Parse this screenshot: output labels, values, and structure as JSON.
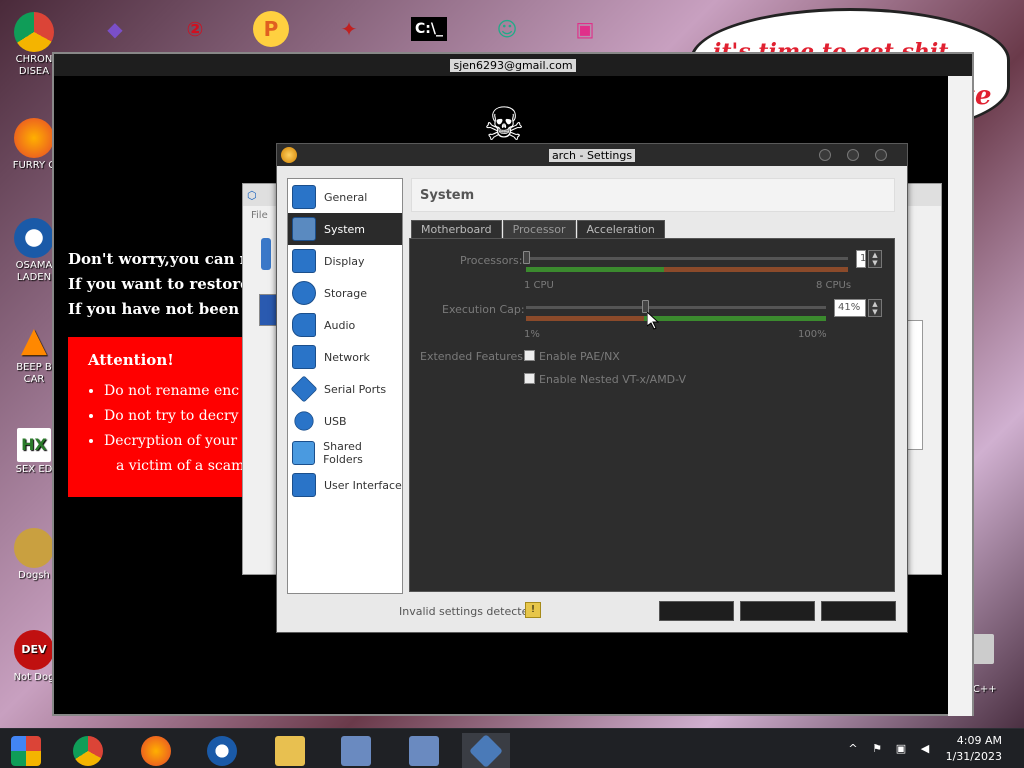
{
  "desktop": {
    "icons": [
      {
        "label": "CHRON\nDISEA",
        "icon": "chrome-icon"
      },
      {
        "label": "FURRY C",
        "icon": "firefox-icon"
      },
      {
        "label": "OSAMA\nLADEN",
        "icon": "obama-icon"
      },
      {
        "label": "BEEP B\nCAR",
        "icon": "vlc-icon"
      },
      {
        "label": "SEX ED",
        "icon": "hex-icon"
      },
      {
        "label": "Dogsh",
        "icon": "dog-icon"
      },
      {
        "label": "Not Dog",
        "icon": "devcpp-icon"
      }
    ],
    "right_labels": [
      "n C++"
    ],
    "speech_text": "it's time to get shit",
    "speech_text2": "te"
  },
  "remote_window": {
    "title": "sjen6293@gmail.com",
    "ransom_lines": [
      "Don't worry,you can ret",
      "If you want to restore t",
      "If you have not been an"
    ],
    "attention_title": "Attention!",
    "attention_items": [
      "Do not rename enc",
      "Do not try to decry",
      "Decryption of your"
    ],
    "attention_cont": "a victim of a scam."
  },
  "vbox_manager": {
    "file_menu": "File"
  },
  "settings_dialog": {
    "title": "arch - Settings",
    "section_title": "System",
    "sidebar": [
      {
        "label": "General",
        "icon": "general-icon",
        "active": false
      },
      {
        "label": "System",
        "icon": "system-icon",
        "active": true
      },
      {
        "label": "Display",
        "icon": "display-icon",
        "active": false
      },
      {
        "label": "Storage",
        "icon": "storage-icon",
        "active": false
      },
      {
        "label": "Audio",
        "icon": "audio-icon",
        "active": false
      },
      {
        "label": "Network",
        "icon": "network-icon",
        "active": false
      },
      {
        "label": "Serial Ports",
        "icon": "serial-ports-icon",
        "active": false
      },
      {
        "label": "USB",
        "icon": "usb-icon",
        "active": false
      },
      {
        "label": "Shared Folders",
        "icon": "shared-folders-icon",
        "active": false
      },
      {
        "label": "User Interface",
        "icon": "user-interface-icon",
        "active": false
      }
    ],
    "tabs": [
      "Motherboard",
      "Processor",
      "Acceleration"
    ],
    "active_tab": "Processor",
    "processors_label": "Processors:",
    "processors_value": "1",
    "processors_min": "1 CPU",
    "processors_max": "8 CPUs",
    "exec_cap_label": "Execution Cap:",
    "exec_cap_value": "41%",
    "exec_cap_min": "1%",
    "exec_cap_max": "100%",
    "extended_label": "Extended Features:",
    "pae_label": "Enable PAE/NX",
    "nested_label": "Enable Nested VT-x/AMD-V",
    "status": "Invalid settings detected"
  },
  "taskbar": {
    "time": "4:09 AM",
    "date": "1/31/2023",
    "items": [
      "start-icon",
      "chrome-icon",
      "firefox-icon",
      "obama-icon",
      "file-explorer-icon",
      "installer-icon",
      "installer2-icon",
      "virtualbox-icon"
    ]
  }
}
